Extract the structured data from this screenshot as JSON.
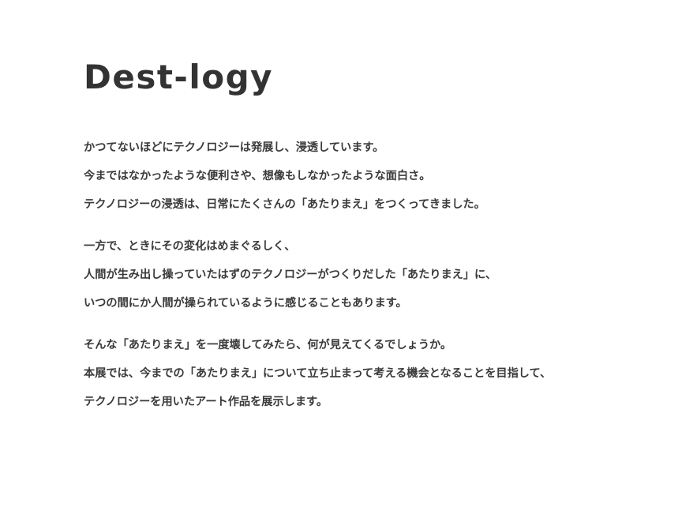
{
  "title": "Dest-logy",
  "paragraphs": [
    {
      "lines": [
        "かつてないほどにテクノロジーは発展し、浸透しています。",
        "今まではなかったような便利さや、想像もしなかったような面白さ。",
        "テクノロジーの浸透は、日常にたくさんの「あたりまえ」をつくってきました。"
      ]
    },
    {
      "lines": [
        "一方で、ときにその変化はめまぐるしく、",
        "人間が生み出し操っていたはずのテクノロジーがつくりだした「あたりまえ」に、",
        "いつの間にか人間が操られているように感じることもあります。"
      ]
    },
    {
      "lines": [
        "そんな「あたりまえ」を一度壊してみたら、何が見えてくるでしょうか。",
        "本展では、今までの「あたりまえ」について立ち止まって考える機会となることを目指して、",
        "テクノロジーを用いたアート作品を展示します。"
      ]
    }
  ]
}
